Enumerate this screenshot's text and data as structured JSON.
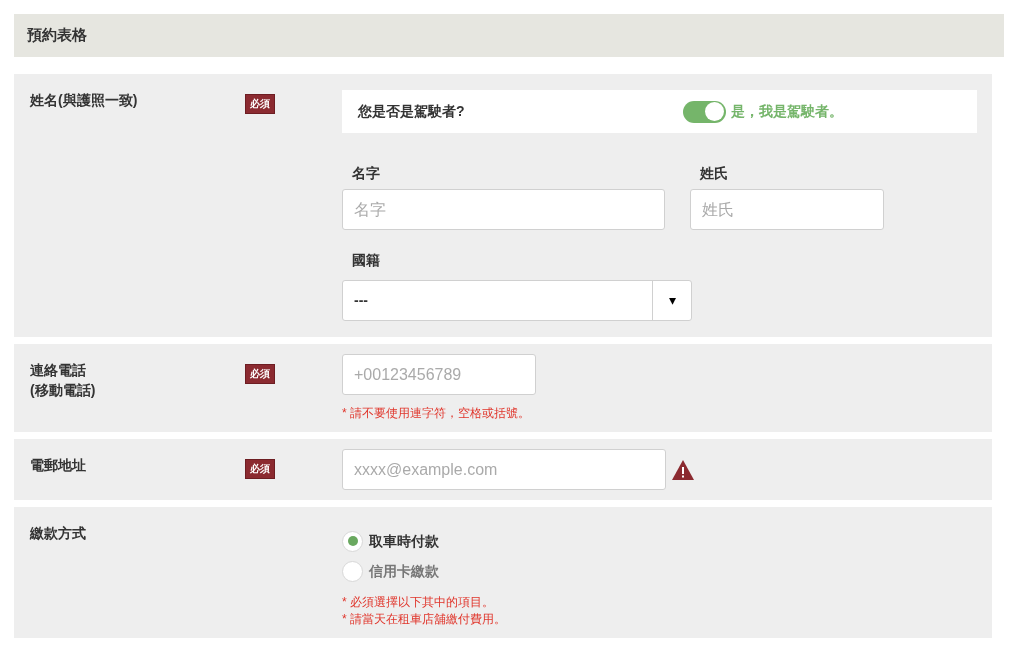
{
  "title": "預約表格",
  "sections": [
    {
      "kind": "name",
      "label": "姓名(與護照一致)",
      "badge": "必須",
      "driver_question": "您是否是駕駛者?",
      "driver_toggle": {
        "on": true,
        "label": "是，我是駕駛者。"
      },
      "fields": [
        {
          "label": "名字",
          "placeholder": "名字"
        },
        {
          "label": "姓氏",
          "placeholder": "姓氏"
        }
      ],
      "nationality": {
        "label": "國籍",
        "value": "---",
        "arrow": "▾"
      }
    },
    {
      "kind": "phone",
      "label": "連絡電話\n(移動電話)",
      "badge": "必須",
      "placeholder": "+00123456789",
      "notes": [
        "* 請不要使用連字符，空格或括號。"
      ]
    },
    {
      "kind": "email",
      "label": "電郵地址",
      "badge": "必須",
      "placeholder": "xxxx@example.com",
      "warning": true
    },
    {
      "kind": "payment",
      "label": "繳款方式",
      "options": [
        {
          "label": "取車時付款",
          "selected": true
        },
        {
          "label": "信用卡繳款",
          "selected": false
        }
      ],
      "notes": [
        "* 必須選擇以下其中的項目。",
        "* 請當天在租車店舖繳付費用。"
      ]
    }
  ]
}
